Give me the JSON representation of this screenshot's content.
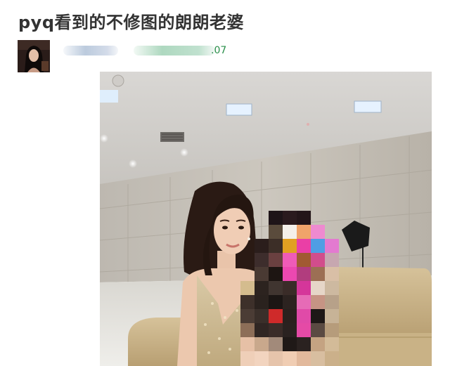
{
  "post": {
    "title": "pyq看到的不修图的朗朗老婆",
    "meta": {
      "date_suffix": ".07"
    }
  },
  "colors": {
    "title": "#333333",
    "meta_date": "#2a8f4a",
    "background": "#ffffff"
  }
}
